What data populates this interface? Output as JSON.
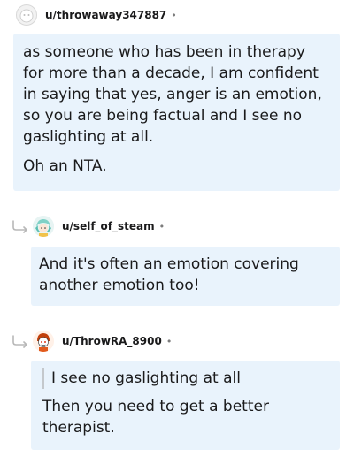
{
  "comments": [
    {
      "username": "u/throwaway347887",
      "separator": "•",
      "paragraphs": [
        "as someone who has been in therapy for more than a decade, I am confident in saying that yes, anger is an emotion, so you are being factual and I see no gaslighting at all.",
        "Oh an NTA."
      ]
    },
    {
      "username": "u/self_of_steam",
      "separator": "•",
      "paragraphs": [
        "And it's often an emotion covering another emotion too!"
      ]
    },
    {
      "username": "u/ThrowRA_8900",
      "separator": "•",
      "quote": "I see no gaslighting at all",
      "paragraphs": [
        "Then you need to get a better therapist."
      ]
    }
  ]
}
